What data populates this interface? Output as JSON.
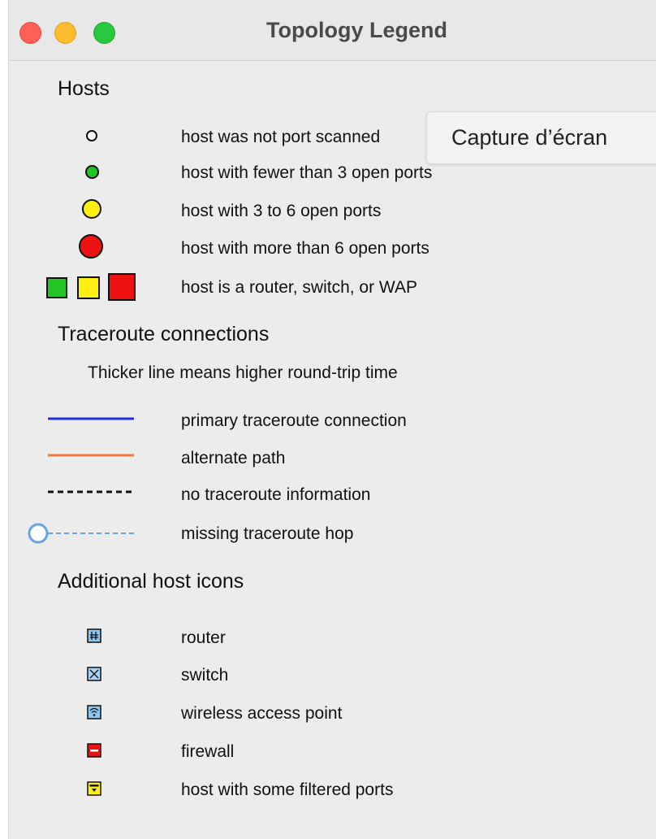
{
  "window": {
    "title": "Topology Legend"
  },
  "hosts": {
    "heading": "Hosts",
    "items": [
      {
        "icon": "white-circle-icon",
        "label": "host was not port scanned",
        "color": "#ffffff"
      },
      {
        "icon": "green-circle-icon",
        "label": "host with fewer than 3 open ports",
        "color": "#22c522"
      },
      {
        "icon": "yellow-circle-icon",
        "label": "host with 3 to 6 open ports",
        "color": "#ffee11"
      },
      {
        "icon": "red-circle-icon",
        "label": "host with more than 6 open ports",
        "color": "#ee1111"
      },
      {
        "icon": "router-squares-icon",
        "label": "host is a router, switch, or WAP",
        "colors": [
          "#22c522",
          "#ffee11",
          "#ee1111"
        ]
      }
    ]
  },
  "traceroute": {
    "heading": "Traceroute connections",
    "note": "Thicker line means higher round-trip time",
    "items": [
      {
        "icon": "blue-line-icon",
        "label": "primary traceroute connection",
        "color": "#1f2fe0"
      },
      {
        "icon": "orange-line-icon",
        "label": "alternate path",
        "color": "#f07a3a"
      },
      {
        "icon": "black-dashed-line-icon",
        "label": "no traceroute information",
        "color": "#111111"
      },
      {
        "icon": "missing-hop-line-icon",
        "label": "missing traceroute hop",
        "color": "#6aa4e6"
      }
    ]
  },
  "additional": {
    "heading": "Additional host icons",
    "items": [
      {
        "icon": "router-icon",
        "label": "router"
      },
      {
        "icon": "switch-icon",
        "label": "switch"
      },
      {
        "icon": "wireless-access-point-icon",
        "label": "wireless access point"
      },
      {
        "icon": "firewall-icon",
        "label": "firewall"
      },
      {
        "icon": "filtered-ports-icon",
        "label": "host with some filtered ports"
      }
    ]
  },
  "tooltip": {
    "text": "Capture d’écran"
  }
}
